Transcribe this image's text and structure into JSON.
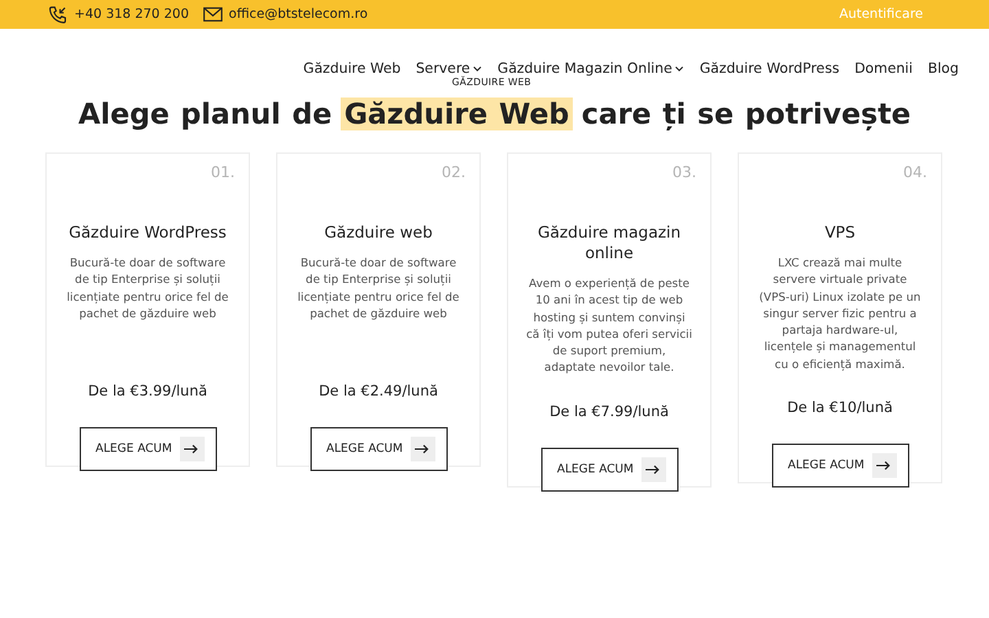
{
  "topbar": {
    "phone": "+40 318 270 200",
    "email": "office@btstelecom.ro",
    "login": "Autentificare"
  },
  "nav": {
    "items": [
      {
        "label": "Găzduire Web",
        "dropdown": false
      },
      {
        "label": "Servere",
        "dropdown": true
      },
      {
        "label": "Găzduire Magazin Online",
        "dropdown": true
      },
      {
        "label": "Găzduire WordPress",
        "dropdown": false
      },
      {
        "label": "Domenii",
        "dropdown": false
      },
      {
        "label": "Blog",
        "dropdown": false
      }
    ],
    "overlay_label": "GĂZDUIRE WEB"
  },
  "heading": {
    "before": "Alege planul de",
    "highlight": "Găzduire Web",
    "after": "care ți se potrivește"
  },
  "plans": [
    {
      "number": "01.",
      "title": "Găzduire WordPress",
      "description": "Bucură-te doar de software de tip Enterprise și soluții licențiate pentru orice fel de pachet de găzduire web",
      "price": "De la €3.99/lună",
      "button": "ALEGE ACUM"
    },
    {
      "number": "02.",
      "title": "Găzduire web",
      "description": "Bucură-te doar de software de tip Enterprise și soluții licențiate pentru orice fel de pachet de găzduire web",
      "price": "De la €2.49/lună",
      "button": "ALEGE ACUM"
    },
    {
      "number": "03.",
      "title": "Găzduire magazin online",
      "description": "Avem o experiență de peste 10 ani în acest tip de web hosting și suntem convinși că îți vom putea oferi servicii de suport premium, adaptate nevoilor tale.",
      "price": "De la €7.99/lună",
      "button": "ALEGE ACUM"
    },
    {
      "number": "04.",
      "title": "VPS",
      "description": "LXC crează mai multe servere virtuale private (VPS-uri) Linux izolate pe un singur server fizic pentru a partaja hardware-ul, licențele și managementul cu o eficiență maximă.",
      "price": "De la €10/lună",
      "button": "ALEGE ACUM"
    }
  ]
}
